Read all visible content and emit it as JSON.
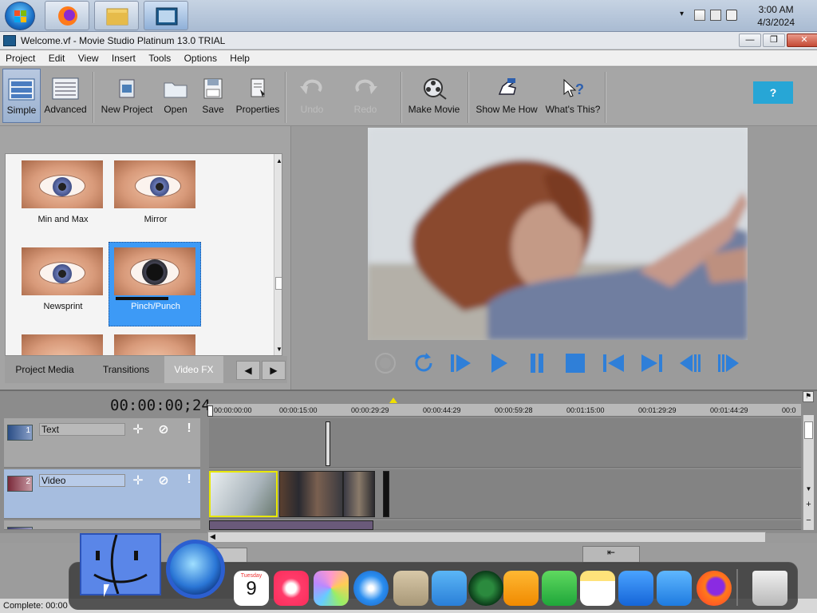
{
  "taskbar": {
    "clock_time": "3:00 AM",
    "clock_date": "4/3/2024",
    "pinned": [
      "firefox-icon",
      "file-explorer-icon",
      "movie-studio-icon"
    ]
  },
  "window": {
    "title": "Welcome.vf - Movie Studio Platinum 13.0 TRIAL",
    "minimize": "—",
    "maximize": "❐",
    "close": "✕"
  },
  "menu": [
    "Project",
    "Edit",
    "View",
    "Insert",
    "Tools",
    "Options",
    "Help"
  ],
  "toolbar": {
    "simple": "Simple",
    "advanced": "Advanced",
    "new_project": "New Project",
    "open": "Open",
    "save": "Save",
    "properties": "Properties",
    "undo": "Undo",
    "redo": "Redo",
    "make_movie": "Make Movie",
    "show_me_how": "Show Me How",
    "whats_this": "What's This?",
    "help_bubble": "?"
  },
  "fx_panel": {
    "items": [
      "Min and Max",
      "Mirror",
      "Newsprint",
      "Pinch/Punch"
    ],
    "selected": "Pinch/Punch",
    "tabs": [
      "Project Media",
      "Transitions",
      "Video FX"
    ],
    "active_tab": "Video FX",
    "nav_prev": "◀",
    "nav_next": "▶"
  },
  "timeline": {
    "timecode": "00:00:00;24",
    "ticks": [
      "00:00:00:00",
      "00:00:15:00",
      "00:00:29:29",
      "00:00:44:29",
      "00:00:59:28",
      "00:01:15:00",
      "00:01:29:29",
      "00:01:44:29",
      "00:0"
    ],
    "tracks": [
      {
        "num": "1",
        "name": "Text"
      },
      {
        "num": "2",
        "name": "Video"
      },
      {
        "num": "3",
        "name": ""
      }
    ]
  },
  "status": {
    "text": "Complete: 00:00"
  },
  "dock": {
    "calendar_month": "Tuesday",
    "calendar_day": "9",
    "apps": [
      "finder-icon",
      "globe-icon",
      "calendar-icon",
      "music-icon",
      "photos-icon",
      "safari-icon",
      "contacts-icon",
      "icloud-icon",
      "find-my-icon",
      "pages-icon",
      "numbers-icon",
      "notes-icon",
      "keynote-icon",
      "mail-icon",
      "firefox-icon",
      "trash-icon"
    ]
  },
  "colors": {
    "accent": "#3d9af6",
    "help": "#27a6d6",
    "toolbar": "#a6a6a6"
  }
}
